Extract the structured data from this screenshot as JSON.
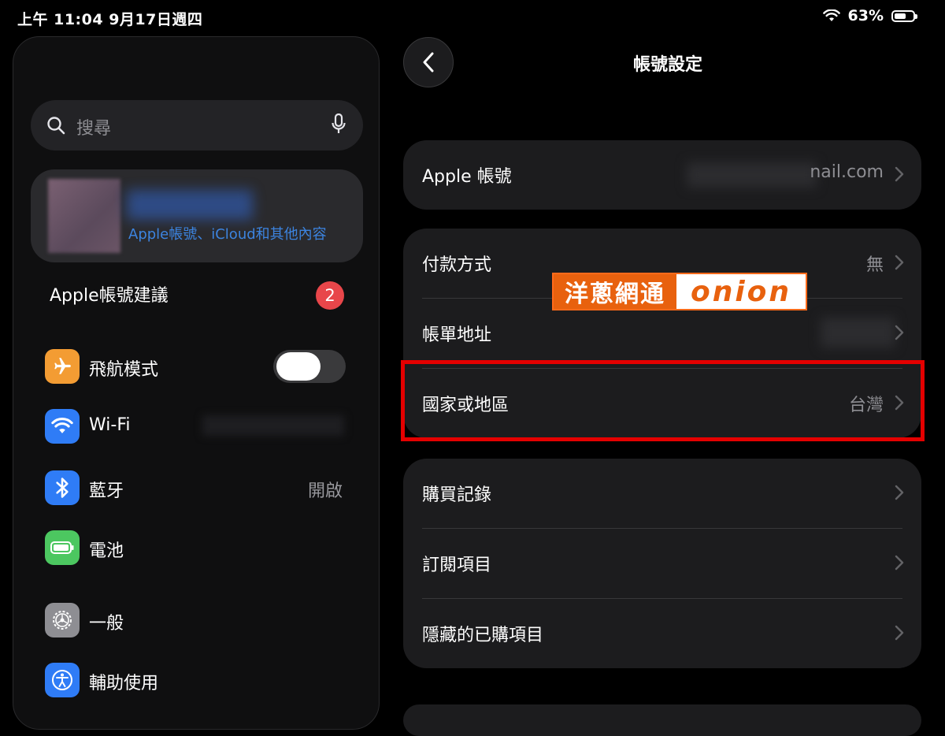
{
  "status_bar": {
    "time": "上午 11:04   9月17日週四",
    "battery_percent": "63%",
    "battery_level": 0.63
  },
  "sidebar": {
    "search_placeholder": "搜尋",
    "profile_subtitle": "Apple帳號、iCloud和其他內容",
    "suggestions_label": "Apple帳號建議",
    "suggestions_count": "2",
    "items": [
      {
        "label": "飛航模式",
        "icon": "airplane-icon",
        "color": "#f39c33",
        "toggle_on": false
      },
      {
        "label": "Wi-Fi",
        "icon": "wifi-icon",
        "color": "#2f7cf6"
      },
      {
        "label": "藍牙",
        "icon": "bluetooth-icon",
        "color": "#2f7cf6",
        "value": "開啟"
      },
      {
        "label": "電池",
        "icon": "battery-icon",
        "color": "#4cc760"
      },
      {
        "label": "一般",
        "icon": "gear-icon",
        "color": "#8e8e93"
      },
      {
        "label": "輔助使用",
        "icon": "accessibility-icon",
        "color": "#2f7cf6"
      }
    ]
  },
  "detail": {
    "title": "帳號設定",
    "group1": [
      {
        "label": "Apple 帳號",
        "value": "nail.com"
      }
    ],
    "group2": [
      {
        "label": "付款方式",
        "value": "無"
      },
      {
        "label": "帳單地址",
        "value": ""
      },
      {
        "label": "國家或地區",
        "value": "台灣"
      }
    ],
    "group3": [
      {
        "label": "購買記錄"
      },
      {
        "label": "訂閱項目"
      },
      {
        "label": "隱藏的已購項目"
      }
    ]
  },
  "watermark": {
    "chinese": "洋蔥網通",
    "english": "onion"
  },
  "colors": {
    "highlight": "#e40000",
    "accent": "#3c84e0",
    "badge": "#e8464a",
    "watermark": "#e8610e"
  }
}
